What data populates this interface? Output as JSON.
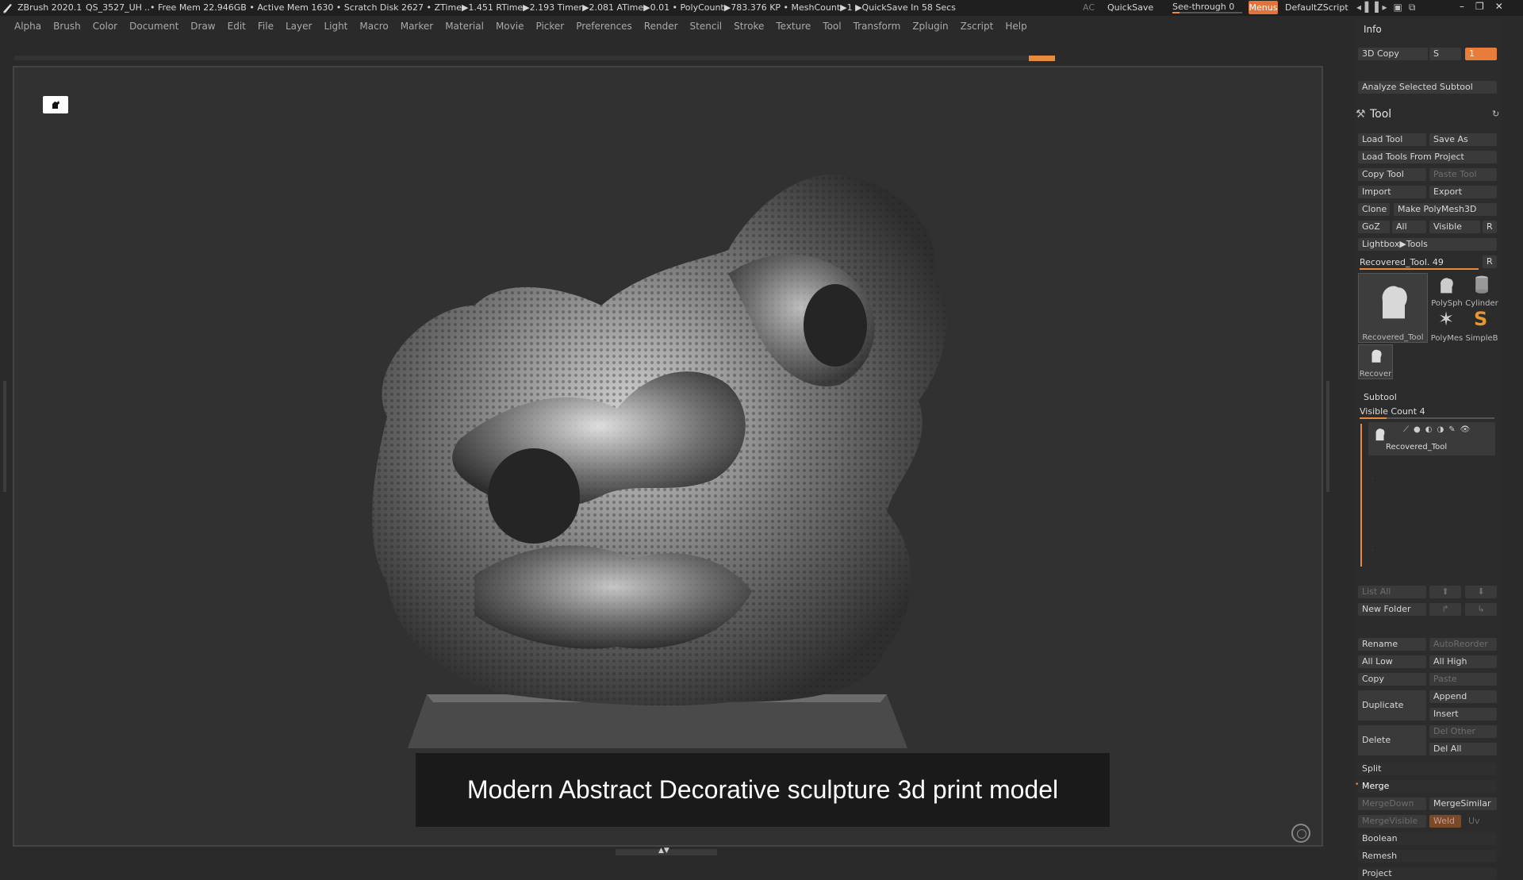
{
  "titlebar": {
    "app": "ZBrush 2020.1",
    "project": "QS_3527_UH",
    "stats": "..• Free Mem 22.946GB • Active Mem 1630 • Scratch Disk 2627 • ZTime▶1.451 RTime▶2.193 Timer▶2.081 ATime▶0.01 • PolyCount▶783.376 KP • MeshCount▶1 ▶QuickSave In 58 Secs",
    "ac": "AC",
    "quicksave": "QuickSave",
    "seethrough_label": "See-through",
    "seethrough_value": "0",
    "seethrough_level": 0.1,
    "menus": "Menus",
    "script": "DefaultZScript"
  },
  "menubar": [
    "Alpha",
    "Brush",
    "Color",
    "Document",
    "Draw",
    "Edit",
    "File",
    "Layer",
    "Light",
    "Macro",
    "Marker",
    "Material",
    "Movie",
    "Picker",
    "Preferences",
    "Render",
    "Stencil",
    "Stroke",
    "Texture",
    "Tool",
    "Transform",
    "Zplugin",
    "Zscript",
    "Help"
  ],
  "viewport": {
    "caption": "Modern Abstract Decorative sculpture 3d print model"
  },
  "panel": {
    "info": "Info",
    "copy3d": "3D Copy",
    "copy3d_s": "S",
    "copy3d_val": "1",
    "analyze": "Analyze Selected Subtool",
    "tool_title": "Tool",
    "load_tool": "Load Tool",
    "save_as": "Save As",
    "load_from_project": "Load Tools From Project",
    "copy_tool": "Copy Tool",
    "paste_tool": "Paste Tool",
    "import": "Import",
    "export": "Export",
    "clone": "Clone",
    "make_polymesh": "Make PolyMesh3D",
    "goz": "GoZ",
    "all": "All",
    "visible": "Visible",
    "r": "R",
    "lightbox": "Lightbox▶Tools",
    "recovered": "Recovered_Tool. 49",
    "recovered_r": "R",
    "thumbs": [
      "Recovered_Tool",
      "PolySph",
      "Cylinder",
      "PolyMes",
      "SimpleB",
      "Recover"
    ],
    "subtool_title": "Subtool",
    "visible_count": "Visible Count 4",
    "visible_count_level": 0.2,
    "subtool_name": "Recovered_Tool",
    "list_all": "List All",
    "new_folder": "New Folder",
    "rename": "Rename",
    "autoreorder": "AutoReorder",
    "all_low": "All Low",
    "all_high": "All High",
    "copy": "Copy",
    "paste": "Paste",
    "duplicate": "Duplicate",
    "append": "Append",
    "insert": "Insert",
    "delete": "Delete",
    "del_other": "Del Other",
    "del_all": "Del All",
    "split": "Split",
    "merge": "Merge",
    "mergedown": "MergeDown",
    "mergesimilar": "MergeSimilar",
    "mergevisible": "MergeVisible",
    "weld": "Weld",
    "uv": "Uv",
    "boolean": "Boolean",
    "remesh": "Remesh",
    "project": "Project"
  }
}
